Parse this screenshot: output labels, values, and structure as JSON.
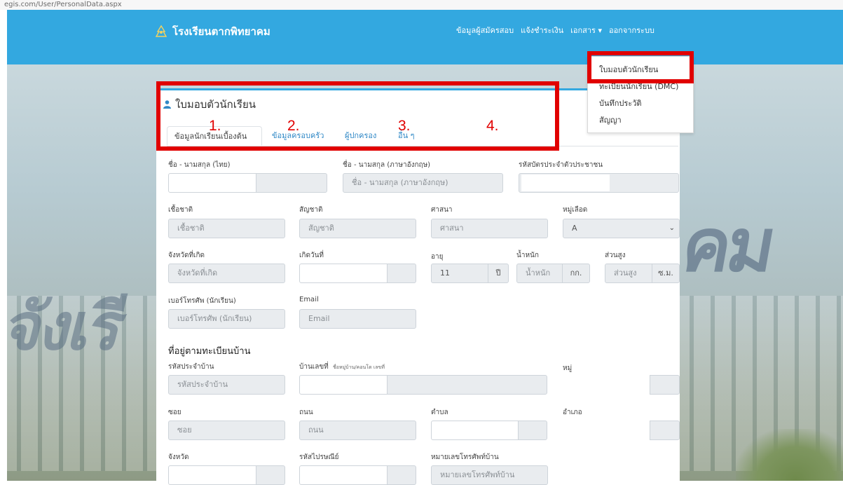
{
  "browser": {
    "url": "egis.com/User/PersonalData.aspx"
  },
  "navbar": {
    "brand": "โรงเรียนตากพิทยาคม",
    "links": [
      "ข้อมูลผู้สมัครสอบ",
      "แจ้งชำระเงิน",
      "เอกสาร ▾",
      "ออกจากระบบ"
    ]
  },
  "dropdown": {
    "items": [
      "ใบมอบตัวนักเรียน",
      "ทะเบียนนักเรียน (DMC)",
      "บันทึกประวัติ",
      "สัญญา"
    ]
  },
  "hero": {
    "text_left": "จังเรี",
    "text_right": "คม"
  },
  "card": {
    "title": "ใบมอบตัวนักเรียน",
    "tabs": [
      "ข้อมูลนักเรียนเบื้องต้น",
      "ข้อมูลครอบครัว",
      "ผู้ปกครอง",
      "อื่น ๆ"
    ],
    "annotations": [
      "1.",
      "2.",
      "3.",
      "4."
    ]
  },
  "form": {
    "name_th_label": "ชื่อ - นามสกุล (ไทย)",
    "name_en_label": "ชื่อ - นามสกุล (ภาษาอังกฤษ)",
    "name_en_placeholder": "ชื่อ - นามสกุล (ภาษาอังกฤษ)",
    "id_label": "รหัสบัตรประจำตัวประชาชน",
    "ethnicity_label": "เชื้อชาติ",
    "ethnicity_placeholder": "เชื้อชาติ",
    "nationality_label": "สัญชาติ",
    "nationality_placeholder": "สัญชาติ",
    "religion_label": "ศาสนา",
    "religion_placeholder": "ศาสนา",
    "blood_label": "หมู่เลือด",
    "blood_value": "A",
    "birth_province_label": "จังหวัดที่เกิด",
    "birth_province_placeholder": "จังหวัดที่เกิด",
    "birthdate_label": "เกิดวันที่",
    "age_label": "อายุ",
    "age_value": "11",
    "age_unit": "ปี",
    "weight_label": "น้ำหนัก",
    "weight_placeholder": "น้ำหนัก",
    "weight_unit": "กก.",
    "height_label": "ส่วนสูง",
    "height_placeholder": "ส่วนสูง",
    "height_unit": "ซ.ม.",
    "phone_label": "เบอร์โทรศัพ (นักเรียน)",
    "phone_placeholder": "เบอร์โทรศัพ (นักเรียน)",
    "email_label": "Email",
    "email_placeholder": "Email",
    "address_heading": "ที่อยู่ตามทะเบียนบ้าน",
    "house_code_label": "รหัสประจำบ้าน",
    "house_code_placeholder": "รหัสประจำบ้าน",
    "house_no_label": "บ้านเลขที่",
    "house_no_hint": "ชื่อหมู่บ้าน/คอนโด เลขที่",
    "moo_label": "หมู่",
    "soi_label": "ซอย",
    "soi_placeholder": "ซอย",
    "road_label": "ถนน",
    "road_placeholder": "ถนน",
    "subdistrict_label": "ตำบล",
    "district_label": "อำเภอ",
    "province_label": "จังหวัด",
    "postcode_label": "รหัสไปรษณีย์",
    "home_phone_label": "หมายเลขโทรศัพท์บ้าน",
    "home_phone_placeholder": "หมายเลขโทรศัพท์บ้าน"
  }
}
